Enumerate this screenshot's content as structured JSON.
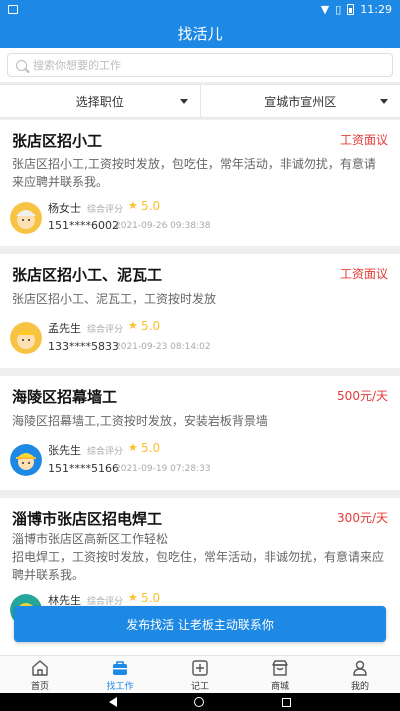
{
  "status_bar": {
    "time": "11:29",
    "icons": [
      "image-icon",
      "wifi-icon",
      "no-sim-icon",
      "battery-icon"
    ]
  },
  "header": {
    "title": "找活儿"
  },
  "search": {
    "placeholder": "搜索你想要的工作"
  },
  "filters": [
    {
      "label": "选择职位"
    },
    {
      "label": "宣城市宣州区"
    }
  ],
  "jobs": [
    {
      "title": "张店区招小工",
      "pay": "工资面议",
      "description": "张店区招小工,工资按时发放，包吃住，常年活动，非诚勿扰，有意请来应聘并联系我。",
      "poster": "杨女士",
      "score_label": "综合评分",
      "score": "5.0",
      "phone": "151****6002",
      "time": "2021-09-26 09:38:38"
    },
    {
      "title": "张店区招小工、泥瓦工",
      "pay": "工资面议",
      "description": "张店区招小工、泥瓦工，工资按时发放",
      "poster": "孟先生",
      "score_label": "综合评分",
      "score": "5.0",
      "phone": "133****5833",
      "time": "2021-09-23 08:14:02"
    },
    {
      "title": "海陵区招幕墙工",
      "pay": "500元/天",
      "description": "海陵区招幕墙工,工资按时发放，安装岩板背景墙",
      "poster": "张先生",
      "score_label": "综合评分",
      "score": "5.0",
      "phone": "151****5166",
      "time": "2021-09-19 07:28:33"
    },
    {
      "title": "淄博市张店区招电焊工",
      "pay": "300元/天",
      "description": "淄博市张店区高新区工作轻松\n招电焊工，工资按时发放，包吃住，常年活动，非诚勿扰，有意请来应聘并联系我。",
      "poster": "林先生",
      "score_label": "综合评分",
      "score": "5.0",
      "phone": "",
      "time": ""
    }
  ],
  "publish_button": {
    "label": "发布找活 让老板主动联系你"
  },
  "tabs": [
    {
      "label": "首页",
      "icon": "home-icon",
      "active": false
    },
    {
      "label": "找工作",
      "icon": "briefcase-icon",
      "active": true
    },
    {
      "label": "记工",
      "icon": "plus-square-icon",
      "active": false
    },
    {
      "label": "商城",
      "icon": "shop-icon",
      "active": false
    },
    {
      "label": "我的",
      "icon": "person-icon",
      "active": false
    }
  ],
  "colors": {
    "primary": "#1e88e5",
    "pay": "#e53935",
    "star": "#fbc02d"
  }
}
